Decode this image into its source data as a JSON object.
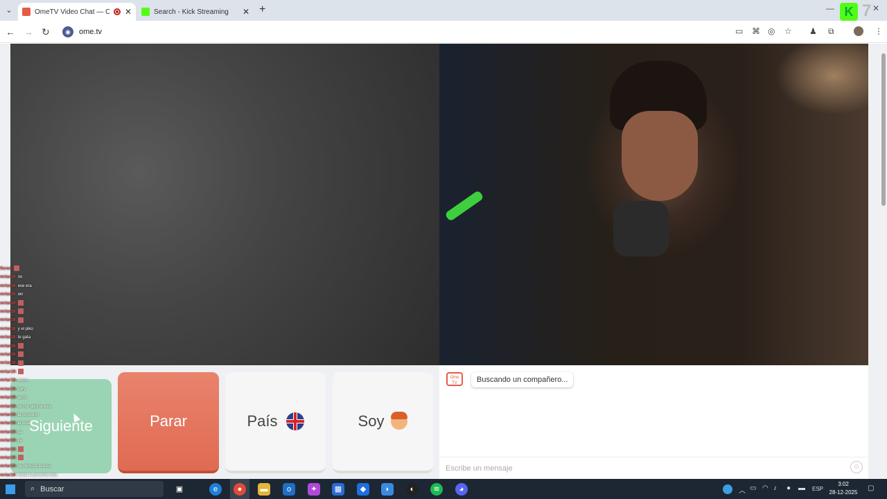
{
  "browser": {
    "tabs": [
      {
        "title": "OmeTV Video Chat — Ome",
        "active": true,
        "favicon_color": "#e55c45"
      },
      {
        "title": "Search - Kick Streaming",
        "active": false,
        "favicon_color": "#53fc18"
      }
    ],
    "url": "ome.tv",
    "kick_overlay_number": "7"
  },
  "page": {
    "buttons": {
      "next": "Siguiente",
      "stop": "Parar",
      "country": "País",
      "gender": "Soy"
    },
    "chat": {
      "logo_text": "Ome TV",
      "status_message": "Buscando un compañero...",
      "input_placeholder": "Escribe un mensaje"
    },
    "colors": {
      "next_button": "#9bd4b4",
      "stop_button": "#e06a52",
      "accent": "#e55c45"
    }
  },
  "stream_chat": [
    {
      "user": "floreo",
      "msg": ""
    },
    {
      "user": "mrtar19",
      "msg": "no"
    },
    {
      "user": "mrtar19",
      "msg": "ese era"
    },
    {
      "user": "mrtar19",
      "msg": "wn"
    },
    {
      "user": "mrtar19",
      "msg": ""
    },
    {
      "user": "mrtar19",
      "msg": ""
    },
    {
      "user": "mrtar19",
      "msg": ""
    },
    {
      "user": "mrtar19",
      "msg": "y el piko"
    },
    {
      "user": "mrtar19",
      "msg": "te gata"
    },
    {
      "user": "mrtar19",
      "msg": ""
    },
    {
      "user": "mrtar19",
      "msg": ""
    },
    {
      "user": "mrtar19",
      "msg": ""
    },
    {
      "user": "mrtar19",
      "msg": ""
    },
    {
      "user": "mrtar19",
      "msg": "wena"
    },
    {
      "user": "mrtar19",
      "msg": "sory"
    },
    {
      "user": "mrtar19",
      "msg": "ando"
    },
    {
      "user": "mrtar19",
      "msg": "se me aqui la wea"
    },
    {
      "user": "mrtar19",
      "msg": "la conexion"
    },
    {
      "user": "mrtar19",
      "msg": "la wea"
    },
    {
      "user": "mrtar19",
      "msg": "ya"
    },
    {
      "user": "mrtar19",
      "msg": "ya"
    },
    {
      "user": "mrtar19",
      "msg": ""
    },
    {
      "user": "mrtar19",
      "msg": ""
    },
    {
      "user": "mrtar19",
      "msg": "se demora la wea"
    },
    {
      "user": "mrtar19",
      "msg": "hasta la proxima wea"
    }
  ],
  "taskbar": {
    "search_label": "Buscar",
    "language": "ESP",
    "time": "3:02",
    "date": "28-12-2025"
  }
}
